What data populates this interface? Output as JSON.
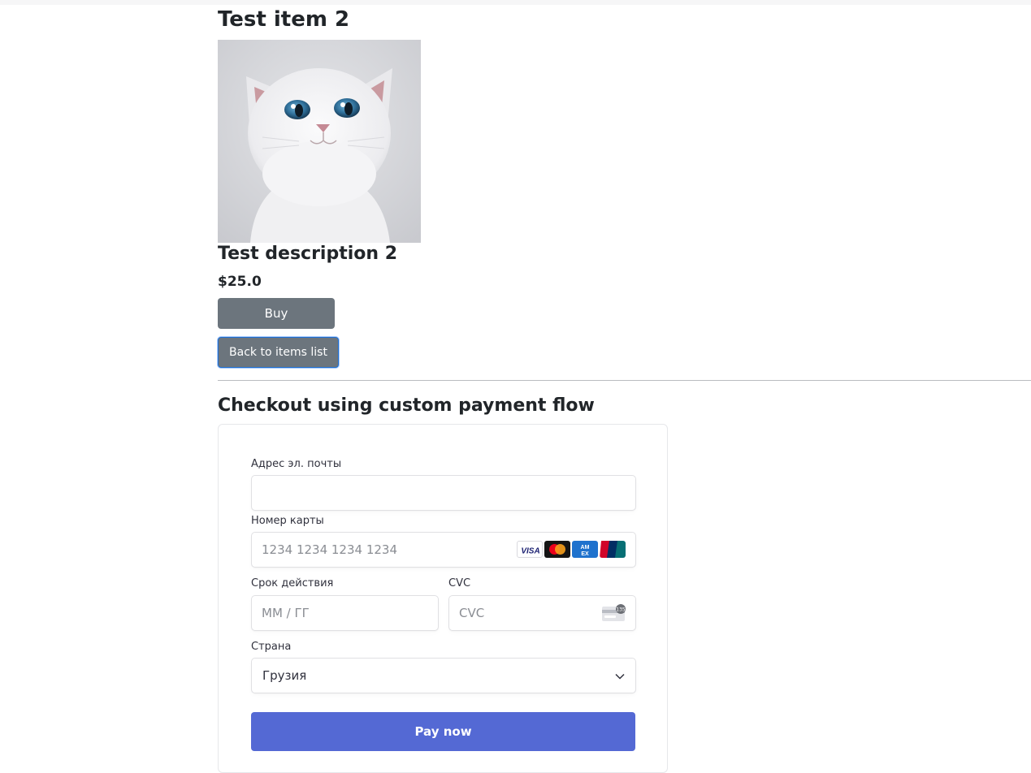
{
  "item": {
    "title": "Test item 2",
    "image_alt": "white cat photo",
    "description": "Test description 2",
    "price": "$25.0",
    "buy_label": "Buy",
    "back_label": "Back to items list"
  },
  "checkout": {
    "title": "Checkout using custom payment flow",
    "email_label": "Адрес эл. почты",
    "email_value": "",
    "card_label": "Номер карты",
    "card_placeholder": "1234 1234 1234 1234",
    "card_brands": [
      "visa-icon",
      "mastercard-icon",
      "amex-icon",
      "unionpay-icon"
    ],
    "expiry_label": "Срок действия",
    "expiry_placeholder": "ММ / ГГ",
    "cvc_label": "CVC",
    "cvc_placeholder": "CVC",
    "country_label": "Страна",
    "country_value": "Грузия",
    "pay_label": "Pay now"
  },
  "colors": {
    "pay_button": "#5469d4",
    "secondary_button": "#6c757d",
    "focus_ring": "#1f6fd1"
  }
}
